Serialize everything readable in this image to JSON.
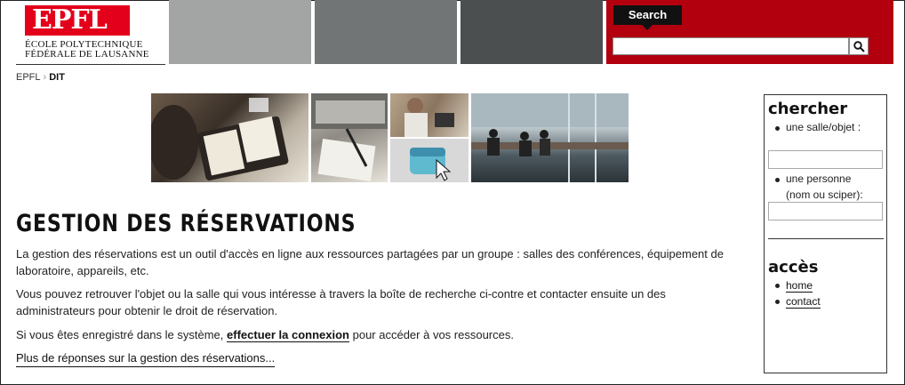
{
  "header": {
    "logo_text": "EPFL",
    "logo_line1": "ÉCOLE POLYTECHNIQUE",
    "logo_line2": "FÉDÉRALE DE LAUSANNE",
    "search_tab": "Search",
    "search_value": "",
    "colors": {
      "accent_red": "#b2000f",
      "logo_red": "#e2001a",
      "block1": "#a3a4a4",
      "block2": "#727575",
      "block3": "#4b4f50"
    }
  },
  "breadcrumb": {
    "root": "EPFL",
    "current": "DIT"
  },
  "main": {
    "title": "GESTION DES RÉSERVATIONS",
    "p1": "La gestion des réservations est un outil d'accès en ligne aux ressources partagées par un groupe : salles des conférences, équipement de laboratoire, appareils, etc.",
    "p2": "Vous pouvez retrouver l'objet ou la salle qui vous intéresse à travers la boîte de recherche ci-contre et contacter ensuite un des administrateurs pour obtenir le droit de réservation.",
    "p3_before": "Si vous êtes enregistré dans le système, ",
    "p3_link": "effectuer la connexion",
    "p3_after": " pour accéder à vos ressources.",
    "more_link": "Plus de réponses sur la gestion des réservations..."
  },
  "sidebar": {
    "search_heading": "chercher",
    "room_label": "une salle/objet :",
    "person_label_1": "une personne",
    "person_label_2": "(nom ou sciper):",
    "access_heading": "accès",
    "home_link": "home",
    "contact_link": "contact"
  }
}
